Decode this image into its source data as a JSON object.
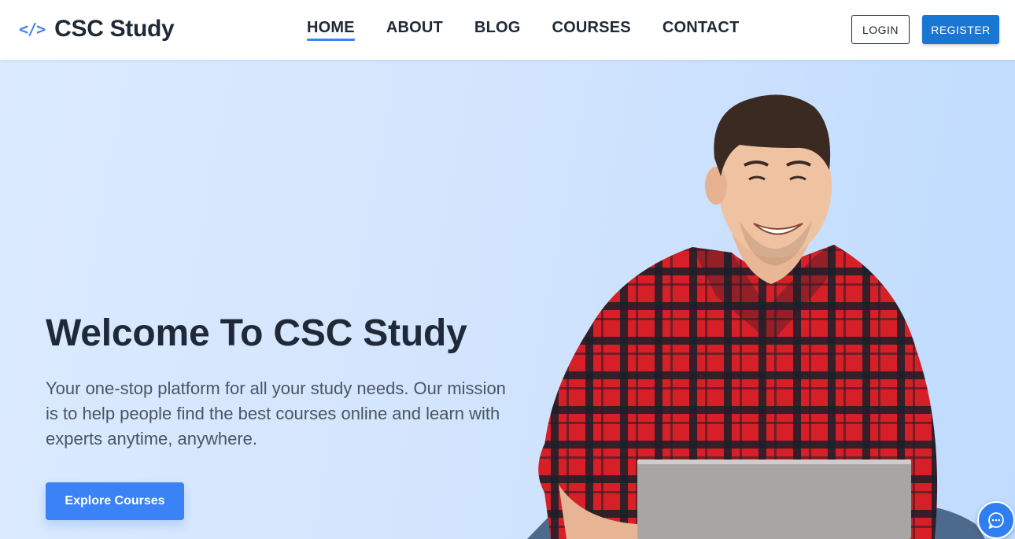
{
  "brand": {
    "icon": "code-icon",
    "icon_text": "</>",
    "name": "CSC Study"
  },
  "nav": {
    "items": [
      {
        "label": "HOME",
        "active": true
      },
      {
        "label": "ABOUT",
        "active": false
      },
      {
        "label": "BLOG",
        "active": false
      },
      {
        "label": "COURSES",
        "active": false
      },
      {
        "label": "CONTACT",
        "active": false
      }
    ]
  },
  "auth": {
    "login_label": "LOGIN",
    "register_label": "REGISTER"
  },
  "hero": {
    "title": "Welcome To CSC Study",
    "description": "Your one-stop platform for all your study needs. Our mission is to help people find the best courses online and learn with experts anytime, anywhere.",
    "cta_label": "Explore Courses",
    "image_icon": "student-with-laptop-illustration"
  },
  "chat": {
    "icon": "chat-bubble-icon"
  },
  "colors": {
    "accent": "#3b82f6",
    "register": "#1976d2",
    "text_dark": "#1f2937",
    "text_muted": "#4b5563",
    "hero_bg_start": "#dbeafe",
    "hero_bg_end": "#bfdbfe"
  }
}
